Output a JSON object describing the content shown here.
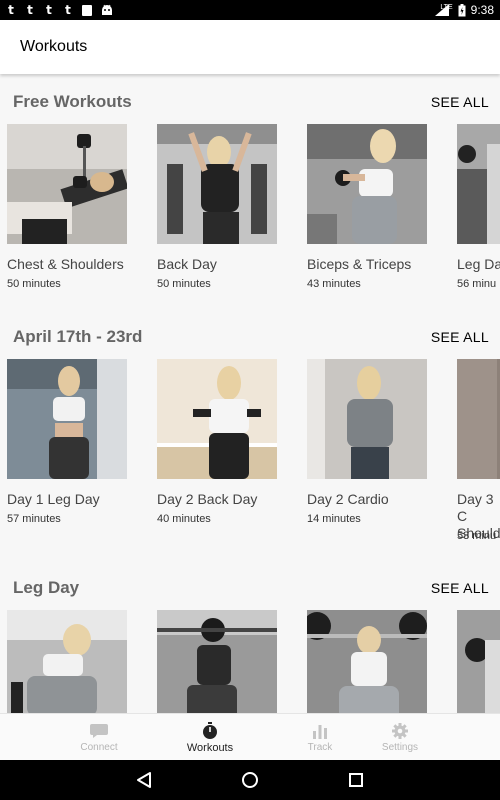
{
  "status_bar": {
    "notifications": [
      "t",
      "t",
      "t",
      "t"
    ],
    "network": "LTE",
    "time": "9:38"
  },
  "app_bar": {
    "title": "Workouts"
  },
  "sections": [
    {
      "title": "Free Workouts",
      "see_all": "SEE ALL",
      "cards": [
        {
          "title": "Chest & Shoulders",
          "duration": "50 minutes"
        },
        {
          "title": "Back Day",
          "duration": "50 minutes"
        },
        {
          "title": "Biceps & Triceps",
          "duration": "43 minutes"
        },
        {
          "title": "Leg Da",
          "duration": "56 minu"
        }
      ]
    },
    {
      "title": "April 17th - 23rd",
      "see_all": "SEE ALL",
      "cards": [
        {
          "title": "Day 1 Leg Day",
          "duration": "57 minutes"
        },
        {
          "title": "Day 2 Back Day",
          "duration": "40 minutes"
        },
        {
          "title": "Day 2 Cardio",
          "duration": "14 minutes"
        },
        {
          "title": "Day 3 C Should",
          "duration": "53 minu"
        }
      ]
    },
    {
      "title": "Leg Day",
      "see_all": "SEE ALL",
      "cards": [
        {
          "title": "",
          "duration": ""
        },
        {
          "title": "",
          "duration": ""
        },
        {
          "title": "",
          "duration": ""
        },
        {
          "title": "",
          "duration": ""
        }
      ]
    }
  ],
  "bottom_nav": [
    {
      "label": "Connect",
      "icon": "chat-bubble-icon",
      "active": false
    },
    {
      "label": "Workouts",
      "icon": "stopwatch-icon",
      "active": true
    },
    {
      "label": "Track",
      "icon": "bar-chart-icon",
      "active": false
    },
    {
      "label": "Settings",
      "icon": "gear-icon",
      "active": false
    }
  ],
  "system_nav": {
    "back": "back-triangle-icon",
    "home": "home-circle-icon",
    "recents": "recents-square-icon"
  }
}
